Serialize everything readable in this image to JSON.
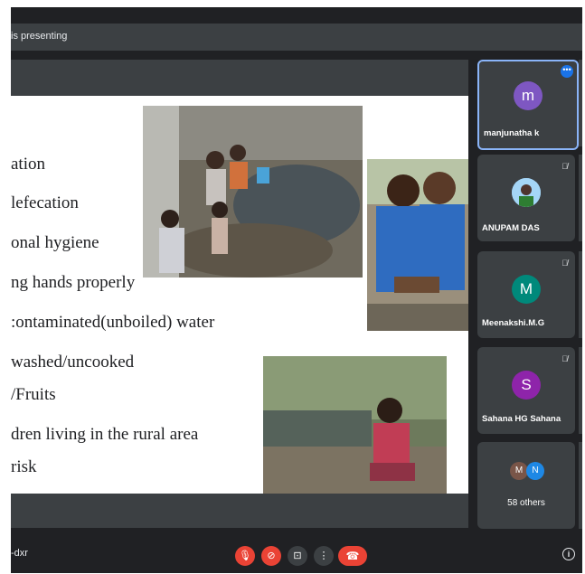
{
  "topbar": {
    "presenting_text": "is presenting"
  },
  "slide": {
    "bullets": [
      "ation",
      "lefecation",
      "onal hygiene",
      "ng hands properly",
      ":ontaminated(unboiled) water",
      "washed/uncooked",
      "/Fruits",
      "dren living in the rural area",
      " risk"
    ]
  },
  "participants": [
    {
      "name": "manjunatha k",
      "initial": "m",
      "color": "#7e57c2",
      "active": true
    },
    {
      "name": "ANUPAM DAS",
      "initial": "",
      "color": "#90caf9"
    },
    {
      "name": "Meenakshi.M.G",
      "initial": "M",
      "color": "#00897b"
    },
    {
      "name": "Sahana HG Sahana",
      "initial": "S",
      "color": "#8e24aa"
    }
  ],
  "others": {
    "label": "58 others",
    "initial1": "M",
    "initial2": "N",
    "color1": "#795548",
    "color2": "#1e88e5"
  },
  "bottombar": {
    "meeting_code": "-dxr"
  },
  "icons": {
    "mic_off": "🎙",
    "cam_off": "⊘",
    "present": "⊡",
    "more": "⋮",
    "end_call": "☎",
    "info": "i"
  }
}
